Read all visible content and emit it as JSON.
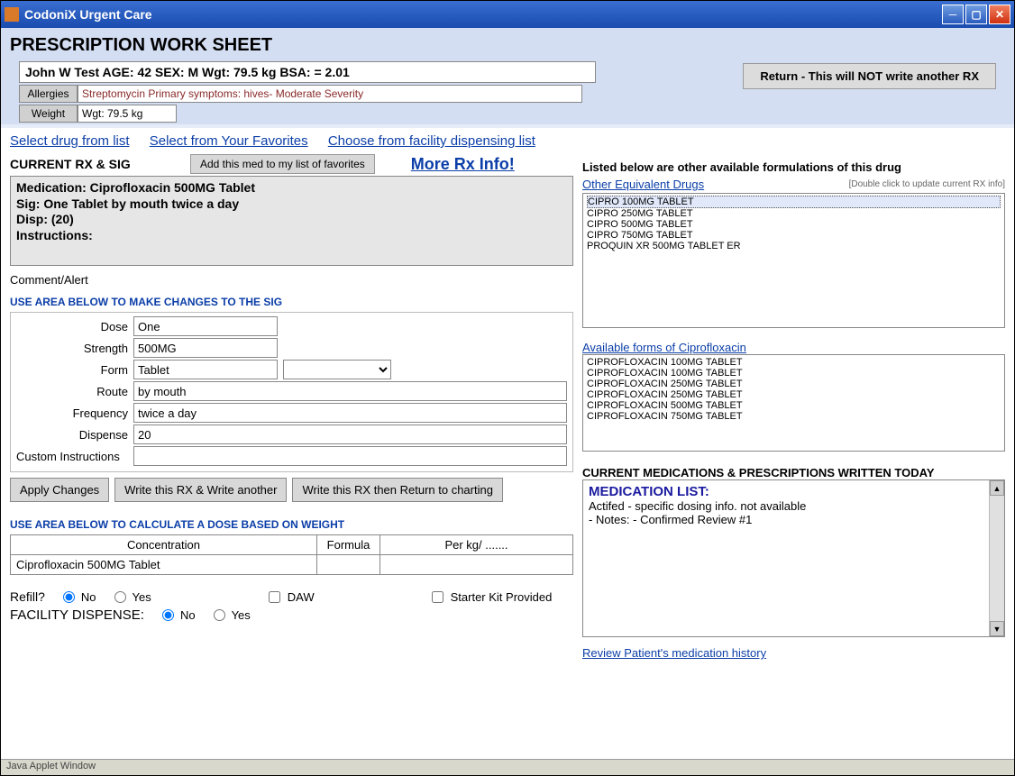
{
  "window": {
    "title": "CodoniX Urgent Care"
  },
  "page": {
    "title": "PRESCRIPTION WORK SHEET",
    "status": "Java Applet Window"
  },
  "patient": {
    "summary": "John W Test    AGE: 42  SEX: M     Wgt: 79.5 kg    BSA:  = 2.01",
    "allergies_label": "Allergies",
    "allergies": "Streptomycin  Primary symptoms: hives- Moderate Severity",
    "weight_label": "Weight",
    "weight": "Wgt: 79.5 kg"
  },
  "buttons": {
    "return": "Return - This will NOT write another RX",
    "add_fav": "Add this med to my list of favorites",
    "apply": "Apply Changes",
    "write_another": "Write this RX & Write another",
    "write_return": "Write this RX then Return to charting"
  },
  "links": {
    "select_drug": "Select drug from list",
    "select_fav": "Select from Your Favorites",
    "choose_facility": "Choose from facility dispensing list",
    "more_rx": "More Rx Info!",
    "other_equiv": "Other Equivalent Drugs",
    "avail_forms": "Available forms of Ciprofloxacin",
    "review_history": "Review Patient's medication history"
  },
  "labels": {
    "current_rx": "CURRENT RX & SIG",
    "comment_alert": "Comment/Alert",
    "make_changes": "USE AREA BELOW TO MAKE CHANGES TO THE SIG",
    "dose": "Dose",
    "strength": "Strength",
    "form": "Form",
    "route": "Route",
    "frequency": "Frequency",
    "dispense": "Dispense",
    "custom": "Custom Instructions",
    "calc_dose": "USE AREA BELOW TO CALCULATE A DOSE BASED ON WEIGHT",
    "concentration": "Concentration",
    "formula": "Formula",
    "per_kg": "Per kg/ .......",
    "refill": "Refill?",
    "no": "No",
    "yes": "Yes",
    "daw": "DAW",
    "starter_kit": "Starter Kit Provided",
    "facility_dispense": "FACILITY DISPENSE:",
    "listed_below": "Listed below are other available formulations of this drug",
    "double_click": "[Double click to update current RX info]",
    "current_meds": "CURRENT MEDICATIONS & PRESCRIPTIONS WRITTEN TODAY",
    "med_list": "MEDICATION LIST:"
  },
  "rx": {
    "line1": "Medication: Ciprofloxacin 500MG Tablet",
    "line2": "Sig: One Tablet by mouth twice a day",
    "line3": "Disp:  (20)",
    "line4": "Instructions:"
  },
  "sig_form": {
    "dose": "One",
    "strength": "500MG",
    "form": "Tablet",
    "route": "by mouth",
    "frequency": "twice a day",
    "dispense": "20",
    "custom": ""
  },
  "calc": {
    "concentration": "Ciprofloxacin 500MG Tablet",
    "formula": "",
    "per_kg": ""
  },
  "equiv_drugs": [
    "CIPRO 100MG TABLET",
    "CIPRO 250MG TABLET",
    "CIPRO 500MG TABLET",
    "CIPRO 750MG TABLET",
    "PROQUIN XR 500MG TABLET ER"
  ],
  "avail_forms": [
    "CIPROFLOXACIN 100MG TABLET",
    "CIPROFLOXACIN 100MG TABLET",
    "CIPROFLOXACIN 250MG TABLET",
    "CIPROFLOXACIN 250MG TABLET",
    "CIPROFLOXACIN 500MG TABLET",
    "CIPROFLOXACIN 750MG TABLET"
  ],
  "med_list": {
    "line1": "Actifed   - specific dosing info. not available",
    "line2": "-    Notes: - Confirmed Review #1"
  }
}
